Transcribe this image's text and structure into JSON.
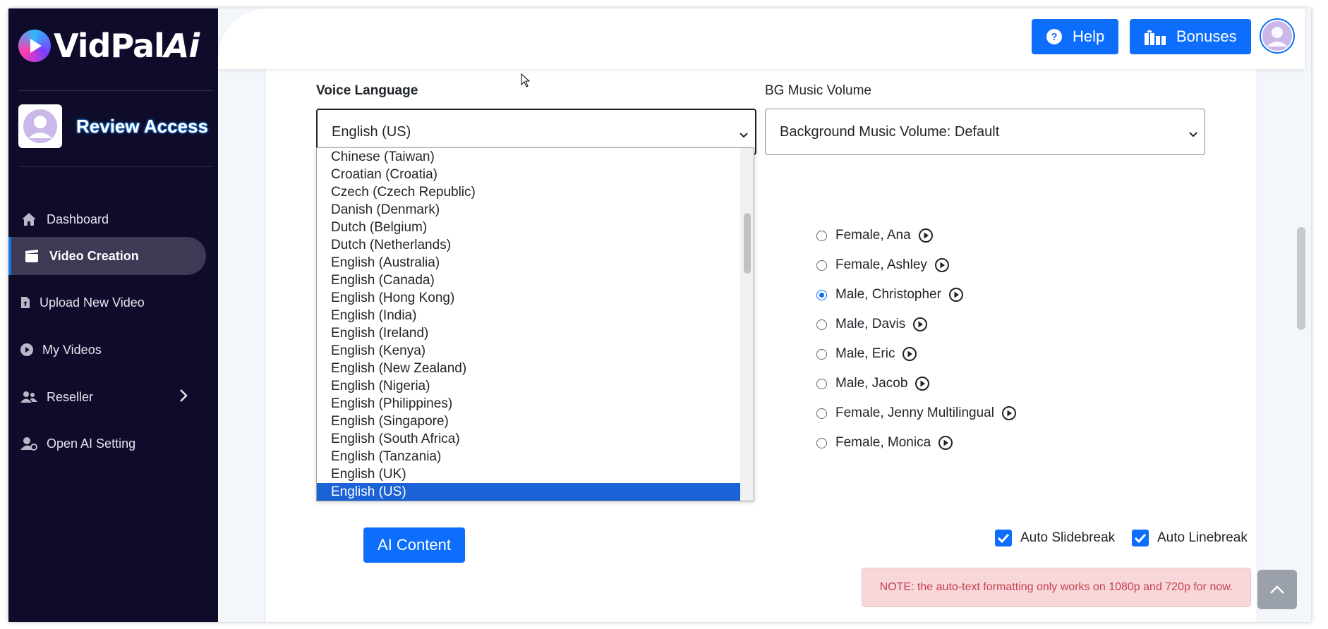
{
  "app": {
    "logo_text": "VidPal",
    "logo_suffix": "Ai"
  },
  "sidebar": {
    "profile_name": "Review Access",
    "items": [
      {
        "label": "Dashboard",
        "icon": "home-icon"
      },
      {
        "label": "Video Creation",
        "icon": "clapperboard-icon",
        "active": true
      },
      {
        "label": "Upload New Video",
        "icon": "file-upload-icon"
      },
      {
        "label": "My Videos",
        "icon": "play-circle-icon"
      },
      {
        "label": "Reseller",
        "icon": "users-icon",
        "has_submenu": true
      },
      {
        "label": "Open AI Setting",
        "icon": "user-gear-icon"
      }
    ]
  },
  "topbar": {
    "help_label": "Help",
    "bonuses_label": "Bonuses"
  },
  "form": {
    "voice_language_label": "Voice Language",
    "voice_language_value": "English (US)",
    "bg_music_label": "BG Music Volume",
    "bg_music_value": "Background Music Volume: Default"
  },
  "language_options": [
    "Chinese (Taiwan)",
    "Croatian (Croatia)",
    "Czech (Czech Republic)",
    "Danish (Denmark)",
    "Dutch (Belgium)",
    "Dutch (Netherlands)",
    "English (Australia)",
    "English (Canada)",
    "English (Hong Kong)",
    "English (India)",
    "English (Ireland)",
    "English (Kenya)",
    "English (New Zealand)",
    "English (Nigeria)",
    "English (Philippines)",
    "English (Singapore)",
    "English (South Africa)",
    "English (Tanzania)",
    "English (UK)",
    "English (US)"
  ],
  "voices": [
    {
      "label": "Female, Ana",
      "selected": false
    },
    {
      "label": "Female, Ashley",
      "selected": false
    },
    {
      "label": "Male, Christopher",
      "selected": true
    },
    {
      "label": "Male, Davis",
      "selected": false
    },
    {
      "label": "Male, Eric",
      "selected": false
    },
    {
      "label": "Male, Jacob",
      "selected": false
    },
    {
      "label": "Female, Jenny Multilingual",
      "selected": false
    },
    {
      "label": "Female, Monica",
      "selected": false
    }
  ],
  "actions": {
    "ai_content_label": "AI Content",
    "auto_slidebreak_label": "Auto Slidebreak",
    "auto_slidebreak_checked": true,
    "auto_linebreak_label": "Auto Linebreak",
    "auto_linebreak_checked": true
  },
  "note": "NOTE: the auto-text formatting only works on 1080p and 720p for now.",
  "colors": {
    "sidebar_bg": "#0e0c2a",
    "accent": "#0d6efd",
    "selected_option": "#1a62d6",
    "note_bg": "#f8d7da",
    "note_text": "#c5414f"
  }
}
